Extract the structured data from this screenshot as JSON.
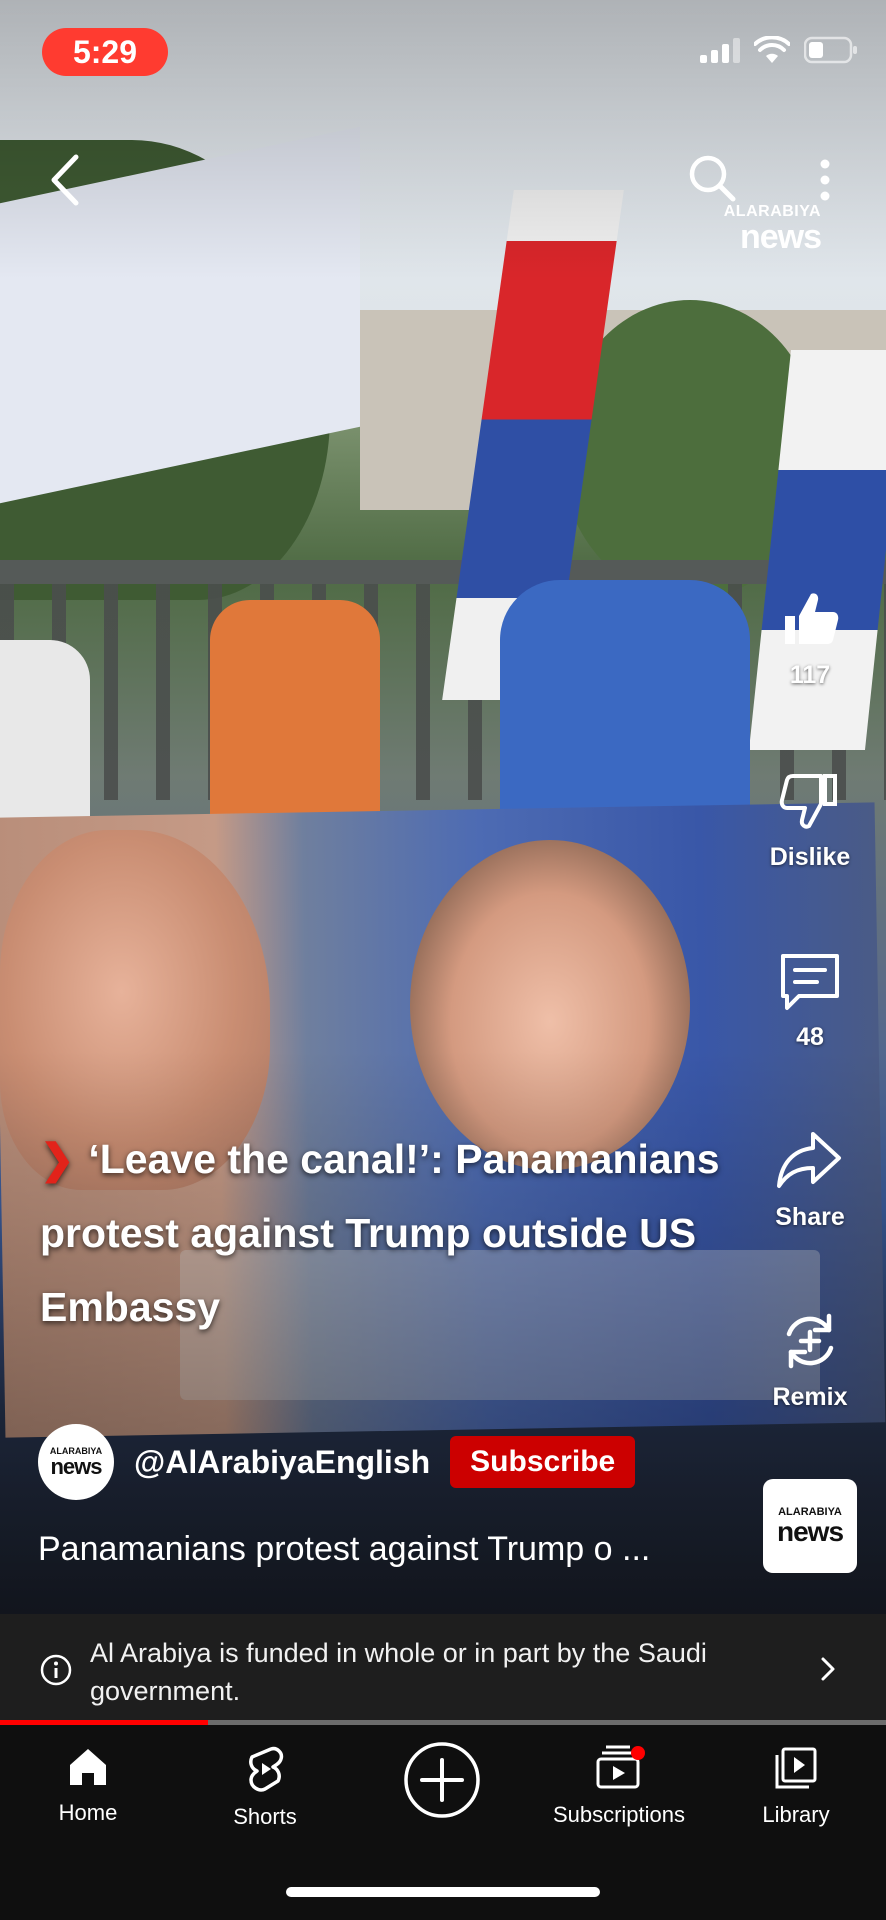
{
  "status": {
    "time": "5:29"
  },
  "video": {
    "brand": {
      "small": "ALARABIYA",
      "big": "news"
    },
    "headline": "‘Leave the canal!’: Panamanians protest against Trump outside US Embassy",
    "headline_chevron": "❯",
    "progress_fraction": 0.235
  },
  "actions": {
    "like_count": "117",
    "dislike_label": "Dislike",
    "comments_count": "48",
    "share_label": "Share",
    "remix_label": "Remix"
  },
  "channel": {
    "avatar": {
      "small": "ALARABIYA",
      "big": "news"
    },
    "handle": "@AlArabiyaEnglish",
    "subscribe_label": "Subscribe"
  },
  "title": "Panamanians protest against Trump o ...",
  "thumb_logo": {
    "small": "ALARABIYA",
    "big": "news"
  },
  "info_bar": {
    "text": "Al Arabiya is funded in whole or in part by the Saudi government."
  },
  "nav": {
    "home": "Home",
    "shorts": "Shorts",
    "subscriptions": "Subscriptions",
    "library": "Library"
  },
  "colors": {
    "accent_red": "#ff0000",
    "subscribe_red": "#cc0000",
    "time_pill": "#ff3b30"
  }
}
